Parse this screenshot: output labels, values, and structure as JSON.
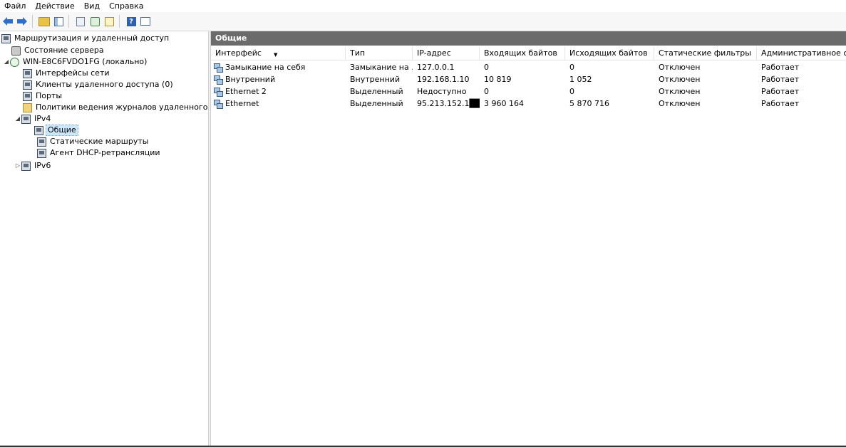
{
  "menu": [
    "Файл",
    "Действие",
    "Вид",
    "Справка"
  ],
  "tree": {
    "root": "Маршрутизация и удаленный доступ",
    "server_status": "Состояние сервера",
    "server": "WIN-E8C6FVDO1FG (локально)",
    "network_interfaces": "Интерфейсы сети",
    "remote_clients": "Клиенты удаленного доступа (0)",
    "ports": "Порты",
    "logging_policies": "Политики ведения журналов удаленного доступ",
    "ipv4": "IPv4",
    "general": "Общие",
    "static_routes": "Статические маршруты",
    "dhcp_relay": "Агент DHCP-ретрансляции",
    "ipv6": "IPv6"
  },
  "content": {
    "title": "Общие",
    "columns": [
      "Интерфейс",
      "Тип",
      "IP-адрес",
      "Входящих байтов",
      "Исходящих байтов",
      "Статические фильтры",
      "Административное состояние"
    ],
    "rows": [
      [
        "Замыкание на себя",
        "Замыкание на ...",
        "127.0.0.1",
        "0",
        "0",
        "Отключен",
        "Работает"
      ],
      [
        "Внутренний",
        "Внутренний",
        "192.168.1.10",
        "10 819",
        "1 052",
        "Отключен",
        "Работает"
      ],
      [
        "Ethernet 2",
        "Выделенный",
        "Недоступно",
        "0",
        "0",
        "Отключен",
        "Работает"
      ],
      [
        "Ethernet",
        "Выделенный",
        "95.213.152.1██",
        "3 960 164",
        "5 870 716",
        "Отключен",
        "Работает"
      ]
    ]
  }
}
